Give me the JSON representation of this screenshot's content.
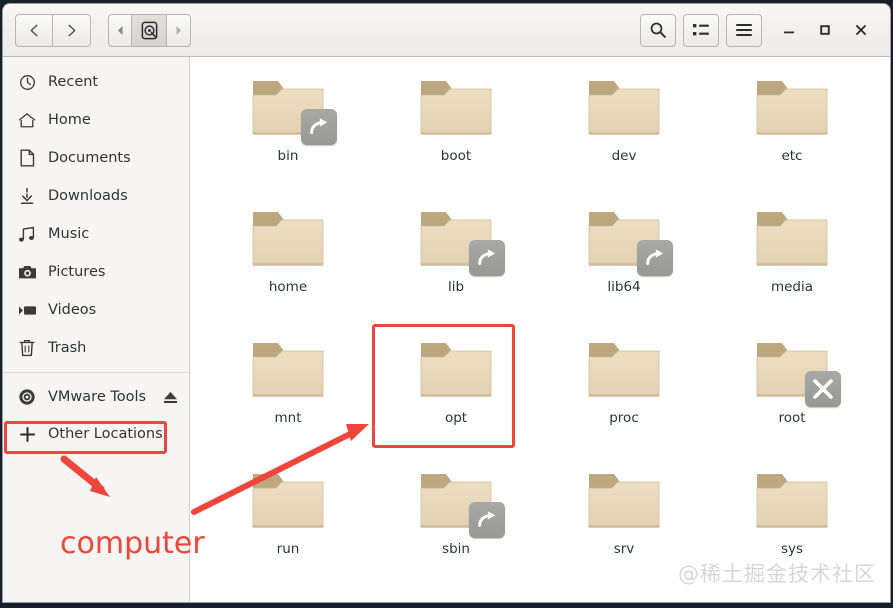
{
  "window": {
    "nav": {
      "back_label": "Back",
      "forward_label": "Forward"
    },
    "breadcrumbs": [
      {
        "name": "prev-crumb",
        "icon": "chevron-left-icon",
        "label": ""
      },
      {
        "name": "root-crumb",
        "icon": "hard-disk-icon",
        "label": ""
      },
      {
        "name": "next-crumb",
        "icon": "chevron-right-icon",
        "label": ""
      }
    ],
    "tools": [
      {
        "name": "search-button",
        "icon": "search-icon",
        "label": "Search"
      },
      {
        "name": "view-toggle-button",
        "icon": "list-view-icon",
        "label": "View options"
      },
      {
        "name": "menu-button",
        "icon": "hamburger-menu-icon",
        "label": "Menu"
      }
    ],
    "controls": [
      {
        "name": "minimize-button",
        "icon": "minimize-icon",
        "label": "Minimize"
      },
      {
        "name": "maximize-button",
        "icon": "maximize-icon",
        "label": "Maximize"
      },
      {
        "name": "close-button",
        "icon": "close-icon",
        "label": "Close"
      }
    ]
  },
  "sidebar": {
    "items": [
      {
        "label": "Recent",
        "icon": "clock-icon"
      },
      {
        "label": "Home",
        "icon": "home-icon"
      },
      {
        "label": "Documents",
        "icon": "document-icon"
      },
      {
        "label": "Downloads",
        "icon": "download-icon"
      },
      {
        "label": "Music",
        "icon": "music-note-icon"
      },
      {
        "label": "Pictures",
        "icon": "camera-icon"
      },
      {
        "label": "Videos",
        "icon": "video-icon"
      },
      {
        "label": "Trash",
        "icon": "trash-icon"
      }
    ],
    "devices": [
      {
        "label": "VMware Tools",
        "icon": "disc-icon",
        "action_icon": "eject-icon"
      }
    ],
    "other": {
      "label": "Other Locations",
      "icon": "plus-icon"
    }
  },
  "files": [
    {
      "label": "bin",
      "emblem": "symlink-icon"
    },
    {
      "label": "boot",
      "emblem": ""
    },
    {
      "label": "dev",
      "emblem": ""
    },
    {
      "label": "etc",
      "emblem": ""
    },
    {
      "label": "home",
      "emblem": ""
    },
    {
      "label": "lib",
      "emblem": "symlink-icon"
    },
    {
      "label": "lib64",
      "emblem": "symlink-icon"
    },
    {
      "label": "media",
      "emblem": ""
    },
    {
      "label": "mnt",
      "emblem": ""
    },
    {
      "label": "opt",
      "emblem": ""
    },
    {
      "label": "proc",
      "emblem": ""
    },
    {
      "label": "root",
      "emblem": "forbidden-icon"
    },
    {
      "label": "run",
      "emblem": ""
    },
    {
      "label": "sbin",
      "emblem": "symlink-icon"
    },
    {
      "label": "srv",
      "emblem": ""
    },
    {
      "label": "sys",
      "emblem": ""
    }
  ],
  "annotations": {
    "callout_text": "computer",
    "accent_color": "#f0453a",
    "highlight_other_locations": true,
    "highlight_opt": true
  },
  "watermark": {
    "text": "@稀土掘金技术社区"
  }
}
